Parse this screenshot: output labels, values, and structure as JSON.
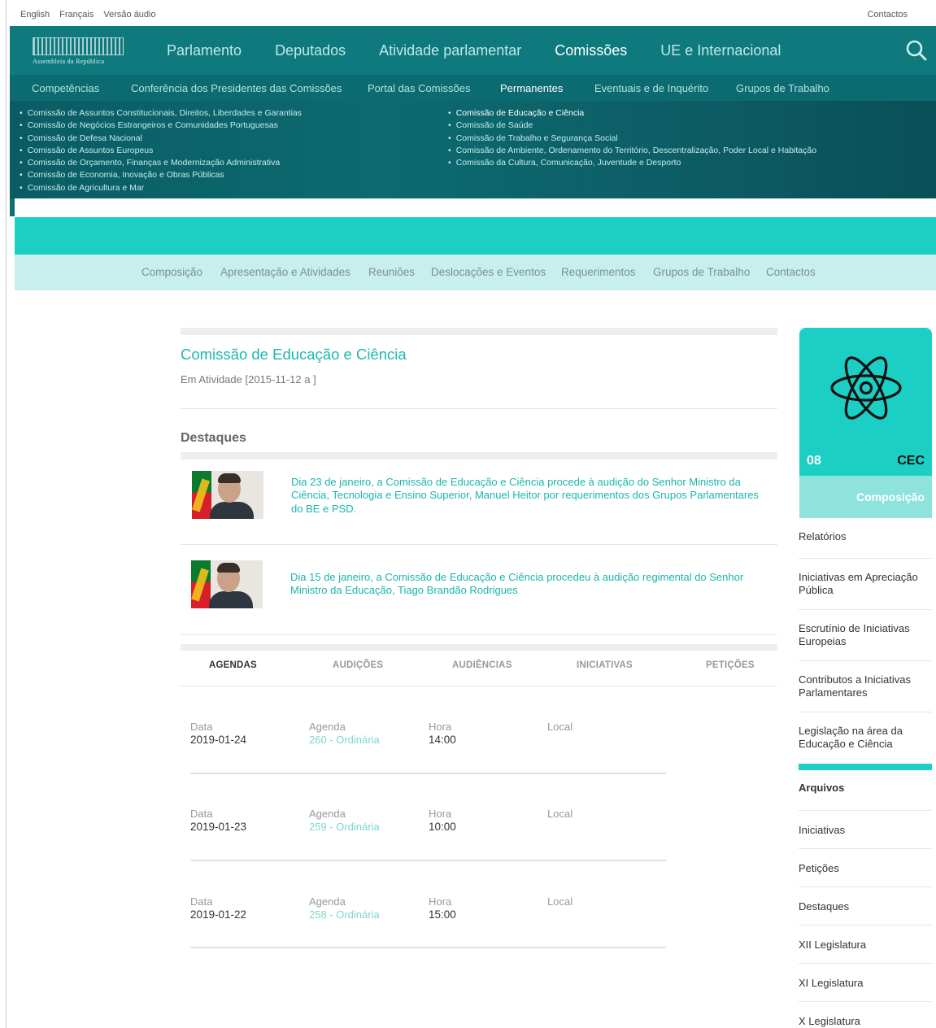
{
  "util": {
    "languages": [
      "English",
      "Français",
      "Versão áudio"
    ],
    "contact": "Contactos"
  },
  "logo": {
    "text": "Assembleia da República"
  },
  "mainnav": {
    "items": [
      "Parlamento",
      "Deputados",
      "Atividade parlamentar",
      "Comissões",
      "UE e Internacional"
    ],
    "active": "Comissões"
  },
  "subnav": {
    "items": [
      "Competências",
      "Conferência dos Presidentes das Comissões",
      "Portal das Comissões",
      "Permanentes",
      "Eventuais e de Inquérito",
      "Grupos de Trabalho"
    ],
    "active": "Permanentes"
  },
  "committees": {
    "left": [
      "Comissão de Assuntos Constitucionais, Direitos, Liberdades e Garantias",
      "Comissão de Negócios Estrangeiros e Comunidades Portuguesas",
      "Comissão de Defesa Nacional",
      "Comissão de Assuntos Europeus",
      "Comissão de Orçamento, Finanças e Modernização Administrativa",
      "Comissão de Economia, Inovação e Obras Públicas",
      "Comissão de Agricultura e Mar"
    ],
    "right": [
      "Comissão de Educação e Ciência",
      "Comissão de Saúde",
      "Comissão de Trabalho e Segurança Social",
      "Comissão de Ambiente, Ordenamento do Território, Descentralização, Poder Local e Habitação",
      "Comissão da Cultura, Comunicação, Juventude e Desporto"
    ]
  },
  "committee_nav": [
    "Composição",
    "Apresentação e Atividades",
    "Reuniões",
    "Deslocações e Eventos",
    "Requerimentos",
    "Grupos de Trabalho",
    "Contactos"
  ],
  "main": {
    "title": "Comissão de Educação e Ciência",
    "status": "Em Atividade [2015-11-12 a  ]",
    "destaques_heading": "Destaques",
    "news": [
      "Dia 23 de janeiro, a Comissão de Educação e Ciência procede à audição do Senhor Ministro da Ciência, Tecnologia e Ensino Superior, Manuel Heitor por requerimentos dos Grupos Parlamentares do BE e PSD.",
      "Dia 15 de janeiro, a Comissão de Educação e Ciência procedeu à audição regimental do Senhor Ministro da Educação, Tiago Brandão Rodrigues"
    ],
    "tabs": [
      "AGENDAS",
      "AUDIÇÕES",
      "AUDIÊNCIAS",
      "INICIATIVAS",
      "PETIÇÕES"
    ],
    "active_tab": "AGENDAS",
    "agenda_labels": {
      "date": "Data",
      "agenda": "Agenda",
      "time": "Hora",
      "place": "Local"
    },
    "agendas": [
      {
        "date": "2019-01-24",
        "agenda": "260 - Ordinária",
        "time": "14:00"
      },
      {
        "date": "2019-01-23",
        "agenda": "259 - Ordinária",
        "time": "10:00"
      },
      {
        "date": "2019-01-22",
        "agenda": "258 - Ordinária",
        "time": "15:00"
      }
    ]
  },
  "sidebar": {
    "number": "08",
    "abbr": "CEC",
    "composicao": "Composição",
    "items": [
      "Relatórios",
      "Iniciativas em Apreciação Pública",
      "Escrutínio de Iniciativas Europeias",
      "Contributos a Iniciativas Parlamentares",
      "Legislação na área da Educação e Ciência"
    ],
    "archive_heading": "Arquivos",
    "archive_items": [
      "Iniciativas",
      "Petições",
      "Destaques",
      "XII Legislatura",
      "XI Legislatura",
      "X Legislatura"
    ]
  },
  "colors": {
    "teal": "#1bcfc5",
    "dark_teal": "#0f7a7e",
    "light_teal": "#c8efee",
    "link": "#1ab5ad"
  },
  "icons": {
    "search": "search-icon",
    "atom": "atom-icon"
  }
}
